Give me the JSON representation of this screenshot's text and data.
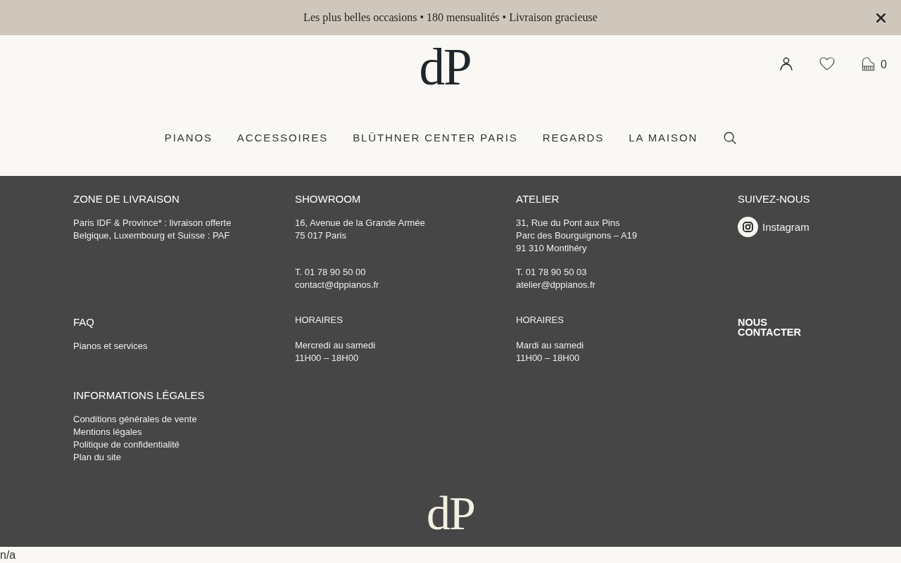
{
  "announcement_bar": {
    "text": "Les plus belles occasions • 180 mensualités • Livraison gracieuse"
  },
  "header": {
    "logo": "dP",
    "cart_count": "0",
    "nav": [
      "PIANOS",
      "ACCESSOIRES",
      "BLÜTHNER CENTER PARIS",
      "REGARDS",
      "LA MAISON"
    ]
  },
  "footer": {
    "sections": [
      {
        "kind": "info",
        "heading": "ZONE DE LIVRAISON",
        "groups": [
          [
            "Paris IDF & Province* : livraison offerte",
            "Belgique, Luxembourg et Suisse : PAF"
          ]
        ]
      },
      {
        "kind": "info",
        "heading": "SHOWROOM",
        "groups": [
          [
            "16, Avenue de la Grande Armée",
            "75 017 Paris"
          ],
          [
            "T. 01 78 90 50 00",
            "contact@dppianos.fr"
          ]
        ]
      },
      {
        "kind": "info",
        "heading": "ATELIER",
        "groups": [
          [
            "31, Rue du Pont aux Pins",
            "Parc des Bourguignons – A19",
            "91 310 Montlhéry"
          ],
          [
            "T. 01 78 90 50 03",
            "atelier@dppianos.fr"
          ]
        ]
      },
      {
        "kind": "social",
        "heading": "SUIVEZ-NOUS",
        "links": [
          "Instagram"
        ]
      },
      {
        "kind": "links",
        "heading": "FAQ",
        "links": [
          "Pianos et services"
        ]
      },
      {
        "kind": "hours",
        "heading": "HORAIRES",
        "lines": [
          "Mercredi au samedi",
          "11H00 – 18H00"
        ]
      },
      {
        "kind": "hours",
        "heading": "HORAIRES",
        "lines": [
          "Mardi au samedi",
          "11H00 – 18H00"
        ]
      },
      {
        "kind": "contact",
        "label": "NOUS CONTACTER"
      },
      {
        "kind": "links",
        "heading": "INFORMATIONS LÉGALES",
        "links": [
          "Conditions générales de vente",
          "Mentions légales",
          "Politique de confidentialité",
          "Plan du site"
        ]
      }
    ],
    "logo": "dP"
  },
  "bottom_note": "n/a"
}
